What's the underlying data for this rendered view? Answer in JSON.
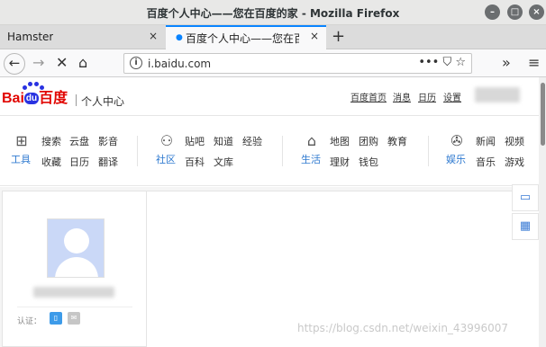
{
  "window": {
    "title": "百度个人中心——您在百度的家 - Mozilla Firefox",
    "controls": {
      "minimize": "–",
      "maximize": "□",
      "close": "×"
    }
  },
  "tabs": [
    {
      "label": "Hamster",
      "close": "×"
    },
    {
      "label": "百度个人中心——您在百度",
      "close": "×"
    }
  ],
  "new_tab": "+",
  "nav": {
    "back": "←",
    "forward": "→",
    "stop": "✕",
    "home": "⌂",
    "info": "i",
    "url": "i.baidu.com",
    "page_actions": "••• ⛉ ☆",
    "overflow": "»",
    "menu": "≡"
  },
  "page": {
    "logo": {
      "bai": "Bai",
      "du": "du",
      "baidu": "百度"
    },
    "center_title": "个人中心",
    "top_links": [
      "百度首页",
      "消息",
      "日历",
      "设置"
    ],
    "groups": [
      {
        "title": "工具",
        "icon": "grid-icon",
        "glyph": "⊞",
        "links": [
          "搜索",
          "云盘",
          "影音",
          "收藏",
          "日历",
          "翻译"
        ]
      },
      {
        "title": "社区",
        "icon": "people-icon",
        "glyph": "⚇",
        "links": [
          "贴吧",
          "知道",
          "经验",
          "百科",
          "文库"
        ]
      },
      {
        "title": "生活",
        "icon": "shop-icon",
        "glyph": "⌂",
        "links": [
          "地图",
          "团购",
          "教育",
          "理财",
          "钱包"
        ]
      },
      {
        "title": "娱乐",
        "icon": "film-reel-icon",
        "glyph": "✇",
        "links": [
          "新闻",
          "视频",
          "音乐",
          "游戏"
        ]
      }
    ],
    "profile": {
      "verify_label": "认证：",
      "phone_icon": "▯",
      "mail_icon": "✉"
    },
    "side_buttons": {
      "chat": "▭",
      "apps": "▦"
    },
    "watermark": "https://blog.csdn.net/weixin_43996007"
  },
  "colors": {
    "accent": "#0a84ff",
    "baidu_red": "#e10602",
    "baidu_blue": "#2932e1",
    "link_blue": "#2f7ad0"
  }
}
